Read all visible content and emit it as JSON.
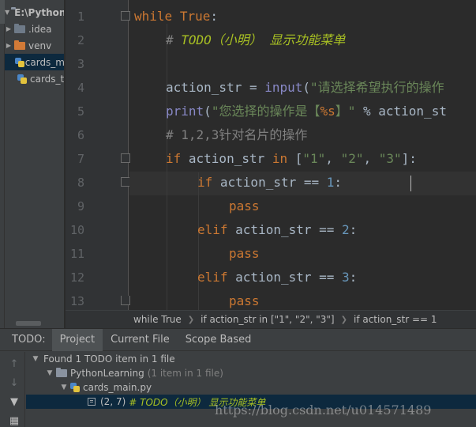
{
  "project": {
    "root_label": "E:\\Python",
    "items": [
      {
        "label": ".idea",
        "type": "folder",
        "color": "#6e7a88"
      },
      {
        "label": "venv",
        "type": "folder",
        "color": "#d27a37"
      },
      {
        "label": "cards_m",
        "type": "python-file"
      },
      {
        "label": "cards_t",
        "type": "python-file"
      }
    ]
  },
  "editor": {
    "line_numbers": [
      "1",
      "2",
      "3",
      "4",
      "5",
      "6",
      "7",
      "8",
      "9",
      "10",
      "11",
      "12",
      "13"
    ],
    "lines": {
      "l1_kw": "while",
      "l1_val": "True",
      "l1_punc": ":",
      "l2_hash": "# ",
      "l2_todo": "TODO（小明） 显示功能菜单",
      "l4_var": "action_str = ",
      "l4_fn": "input",
      "l4_paren": "(",
      "l4_str": "\"请选择希望执行的操作",
      "l5_fn": "print",
      "l5_paren": "(",
      "l5_str1": "\"您选择的操作是【",
      "l5_fmt": "%s",
      "l5_str2": "】\"",
      "l5_rest": " % action_st",
      "l6_cmt": "# 1,2,3针对名片的操作",
      "l7_kw": "if",
      "l7_var": " action_str ",
      "l7_in": "in",
      "l7_open": " [",
      "l7_s1": "\"1\"",
      "l7_c1": ", ",
      "l7_s2": "\"2\"",
      "l7_c2": ", ",
      "l7_s3": "\"3\"",
      "l7_close": "]:",
      "l8_kw": "if",
      "l8_var": " action_str == ",
      "l8_num": "1",
      "l8_punc": ":",
      "l9_kw": "pass",
      "l10_kw": "elif",
      "l10_var": " action_str == ",
      "l10_num": "2",
      "l10_punc": ":",
      "l11_kw": "pass",
      "l12_kw": "elif",
      "l12_var": " action_str == ",
      "l12_num": "3",
      "l12_punc": ":",
      "l13_kw": "pass"
    }
  },
  "breadcrumb": [
    "while True",
    "if action_str in [\"1\", \"2\", \"3\"]",
    "if action_str == 1"
  ],
  "todo_panel": {
    "label": "TODO:",
    "tabs": [
      "Project",
      "Current File",
      "Scope Based"
    ],
    "active_tab": "Project",
    "summary": "Found 1 TODO item in 1 file",
    "project_name": "PythonLearning",
    "project_count": "(1 item in 1 file)",
    "file_name": "cards_main.py",
    "item_coord": "(2, 7)",
    "item_text": "# TODO（小明） 显示功能菜单"
  },
  "watermark": "https://blog.csdn.net/u014571489",
  "colors": {
    "keyword": "#cc7832",
    "string": "#6a8759",
    "number": "#6897bb",
    "builtin": "#8888c6",
    "todo": "#a8c023",
    "comment": "#808080"
  }
}
